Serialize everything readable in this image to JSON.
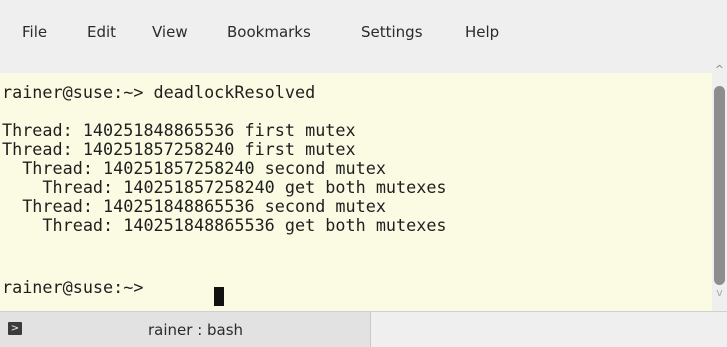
{
  "menu": {
    "items": [
      "File",
      "Edit",
      "View",
      "Bookmarks",
      "Settings",
      "Help"
    ]
  },
  "terminal": {
    "lines": [
      "rainer@suse:~> deadlockResolved",
      "",
      "Thread: 140251848865536 first mutex",
      "Thread: 140251857258240 first mutex",
      "  Thread: 140251857258240 second mutex",
      "    Thread: 140251857258240 get both mutexes",
      "  Thread: 140251848865536 second mutex",
      "    Thread: 140251848865536 get both mutexes",
      "",
      "rainer@suse:~> "
    ]
  },
  "tab": {
    "label": "rainer : bash",
    "icon": "terminal-icon"
  }
}
